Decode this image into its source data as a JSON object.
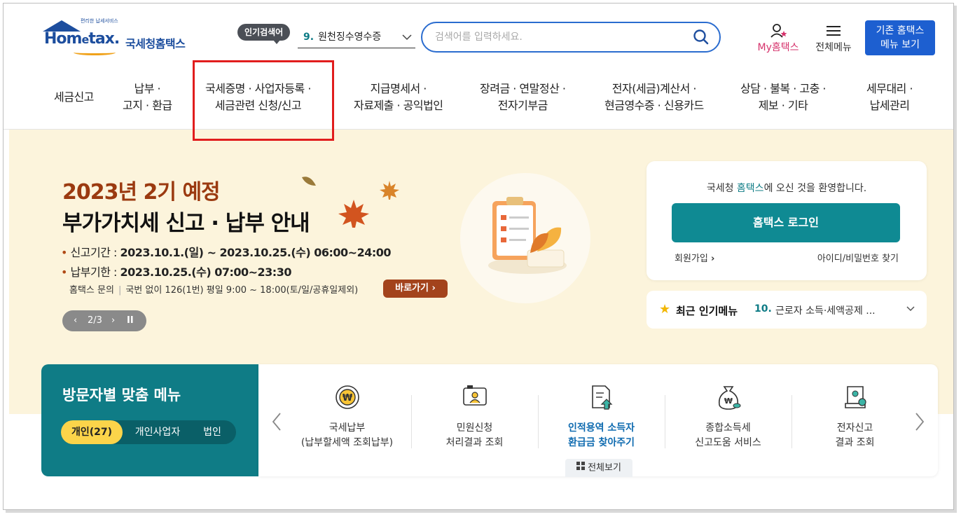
{
  "header": {
    "logo_slogan": "편리한 납세서비스",
    "logo_brand_pre": "Hom",
    "logo_brand_e": "e",
    "logo_brand_post": "tax.",
    "logo_name": "국세청홈택스",
    "popular_badge": "인기검색어",
    "popular_number": "9.",
    "popular_term": "원천징수영수증",
    "search_placeholder": "검색어를 입력하세요.",
    "my_hometax": "My홈택스",
    "all_menu": "전체메뉴",
    "legacy_line1": "기존 홈택스",
    "legacy_line2": "메뉴 보기"
  },
  "gnb": {
    "items": [
      {
        "line1": "세금신고",
        "line2": ""
      },
      {
        "line1": "납부 ·",
        "line2": "고지 · 환급"
      },
      {
        "line1": "국세증명 · 사업자등록 ·",
        "line2": "세금관련 신청/신고"
      },
      {
        "line1": "지급명세서 ·",
        "line2": "자료제출 · 공익법인"
      },
      {
        "line1": "장려금 · 연말정산 ·",
        "line2": "전자기부금"
      },
      {
        "line1": "전자(세금)계산서 ·",
        "line2": "현금영수증 · 신용카드"
      },
      {
        "line1": "상담 · 불복 · 고충 ·",
        "line2": "제보 · 기타"
      },
      {
        "line1": "세무대리 ·",
        "line2": "납세관리"
      }
    ]
  },
  "banner": {
    "title1": "2023년 2기 예정",
    "title2": "부가가치세 신고 · 납부 안내",
    "line1_label": "신고기간 : ",
    "line1_value": "2023.10.1.(일) ~ 2023.10.25.(수) 06:00~24:00",
    "line2_label": "납부기한 : ",
    "line2_value": "2023.10.25.(수) 07:00~23:30",
    "inquiry_label": "홈택스 문의",
    "inquiry_value": "국번 없이 126(1번) 평일 9:00 ~ 18:00(토/일/공휴일제외)",
    "go_button": "바로가기",
    "pager_text": "2/3"
  },
  "login": {
    "welcome_pre": "국세청 ",
    "welcome_hl": "홈택스",
    "welcome_post": "에 오신 것을 환영합니다.",
    "login_button": "홈택스 로그인",
    "join": "회원가입",
    "find": "아이디/비밀번호 찾기"
  },
  "recent": {
    "label": "최근 인기메뉴",
    "number": "10.",
    "text": "근로자 소득·세액공제 ..."
  },
  "visitor": {
    "title": "방문자별 맞춤 메뉴",
    "tabs": [
      "개인(27)",
      "개인사업자",
      "법인"
    ],
    "items": [
      {
        "line1": "국세납부",
        "line2": "(납부할세액 조회납부)",
        "icon": "won-coin-icon"
      },
      {
        "line1": "민원신청",
        "line2": "처리결과 조회",
        "icon": "monitor-person-icon"
      },
      {
        "line1": "인적용역 소득자",
        "line2": "환급금 찾아주기",
        "icon": "document-arrow-icon"
      },
      {
        "line1": "종합소득세",
        "line2": "신고도움 서비스",
        "icon": "money-bag-icon"
      },
      {
        "line1": "전자신고",
        "line2": "결과 조회",
        "icon": "scroll-check-icon"
      }
    ],
    "view_all": "전체보기"
  },
  "colors": {
    "brand_blue": "#1d4e9e",
    "teal": "#0f7c86",
    "highlight_red": "#e11d1d",
    "banner_bg": "#fcf4dc",
    "tab_active": "#fbd44a"
  }
}
